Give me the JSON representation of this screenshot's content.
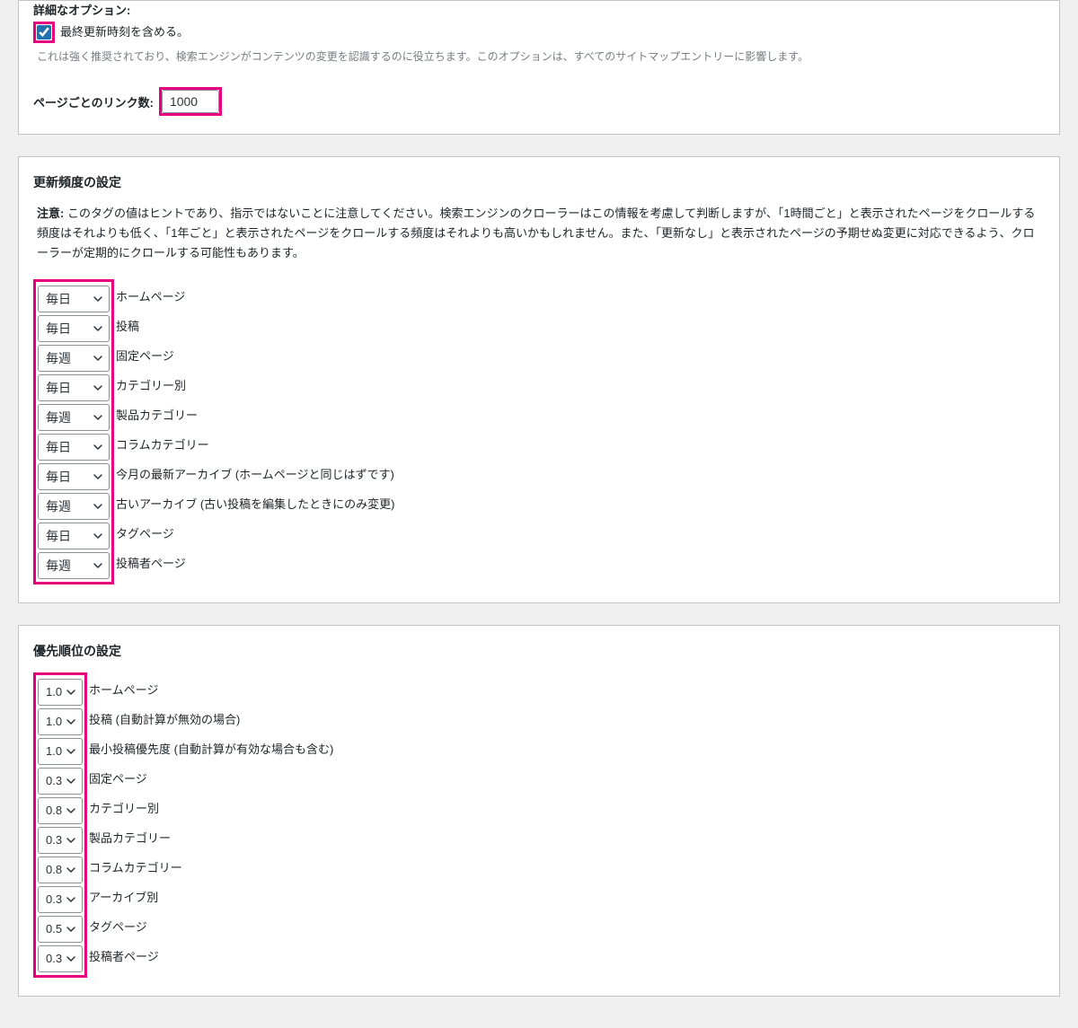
{
  "advanced": {
    "title": "詳細なオプション:",
    "include_lastmod_label": "最終更新時刻を含める。",
    "include_lastmod_desc": "これは強く推奨されており、検索エンジンがコンテンツの変更を認識するのに役立ちます。このオプションは、すべてのサイトマップエントリーに影響します。",
    "links_per_page_label": "ページごとのリンク数:",
    "links_per_page_value": "1000"
  },
  "frequency": {
    "title": "更新頻度の設定",
    "note_label": "注意:",
    "note_text": " このタグの値はヒントであり、指示ではないことに注意してください。検索エンジンのクローラーはこの情報を考慮して判断しますが、「1時間ごと」と表示されたページをクロールする頻度はそれよりも低く、「1年ごと」と表示されたページをクロールする頻度はそれよりも高いかもしれません。また、「更新なし」と表示されたページの予期せぬ変更に対応できるよう、クローラーが定期的にクロールする可能性もあります。",
    "rows": [
      {
        "value": "毎日",
        "label": "ホームページ"
      },
      {
        "value": "毎日",
        "label": "投稿"
      },
      {
        "value": "毎週",
        "label": "固定ページ"
      },
      {
        "value": "毎日",
        "label": "カテゴリー別"
      },
      {
        "value": "毎週",
        "label": "製品カテゴリー"
      },
      {
        "value": "毎日",
        "label": "コラムカテゴリー"
      },
      {
        "value": "毎日",
        "label": "今月の最新アーカイブ (ホームページと同じはずです)"
      },
      {
        "value": "毎週",
        "label": "古いアーカイブ (古い投稿を編集したときにのみ変更)"
      },
      {
        "value": "毎日",
        "label": "タグページ"
      },
      {
        "value": "毎週",
        "label": "投稿者ページ"
      }
    ]
  },
  "priority": {
    "title": "優先順位の設定",
    "rows": [
      {
        "value": "1.0",
        "label": "ホームページ"
      },
      {
        "value": "1.0",
        "label": "投稿 (自動計算が無効の場合)"
      },
      {
        "value": "1.0",
        "label": "最小投稿優先度 (自動計算が有効な場合も含む)"
      },
      {
        "value": "0.3",
        "label": "固定ページ"
      },
      {
        "value": "0.8",
        "label": "カテゴリー別"
      },
      {
        "value": "0.3",
        "label": "製品カテゴリー"
      },
      {
        "value": "0.8",
        "label": "コラムカテゴリー"
      },
      {
        "value": "0.3",
        "label": "アーカイブ別"
      },
      {
        "value": "0.5",
        "label": "タグページ"
      },
      {
        "value": "0.3",
        "label": "投稿者ページ"
      }
    ]
  }
}
